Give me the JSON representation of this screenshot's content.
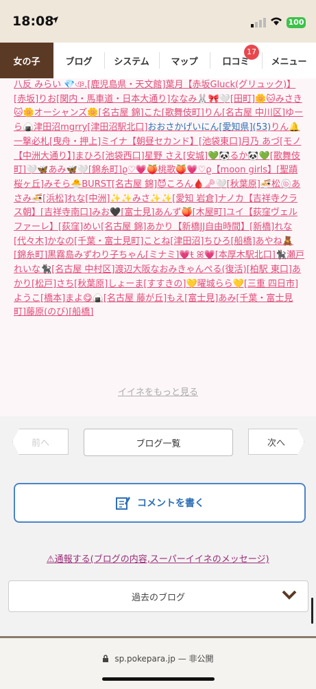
{
  "status": {
    "time": "18:08",
    "battery": "100"
  },
  "nav": {
    "tabs": [
      {
        "label": "女の子"
      },
      {
        "label": "ブログ"
      },
      {
        "label": "システム"
      },
      {
        "label": "マップ"
      },
      {
        "label": "口コミ"
      },
      {
        "label": "メニュー"
      }
    ],
    "review_badge": "17"
  },
  "likes": {
    "names": [
      "八反 みらい 💎ঞ.[鹿児島県・天文館]",
      "葉月【赤坂Gluck(グリュック)】[赤坂]",
      "りお[関内・馬車道・日本大通り]",
      "ななみ🐰🎀🤍[田町]",
      "🌼🐱みさき🐱🌼オーシャンズ🌼[名古屋 錦]",
      "こた[歌舞伎町]",
      "りん[名古屋 中川区]",
      "ゆーら🍙津田沼mgrry[津田沼駅北口]"
    ],
    "blue_name": "おおさかげいにん[愛知県](53)",
    "names2": [
      "りん🔔一撃必札[曳舟・押上]",
      "ミイナ【朝昼セカンド】[池袋東口]",
      "月乃 あづ[モノ【中洲大通り】]",
      "まひろ[池袋西口]",
      "星野 さえ[安城]💚🐼るか🐼💚[歌舞伎町]",
      "🤍🦋あみ🦋🤍[錦糸町]",
      "ϱ♡💗🍑桃歌🍑💗♡ϱ【moon girls】[聖蹟桜ヶ丘]",
      "みそら🐣BURST[名古屋 錦]",
      "😈ころん🩸🗝🤍[秋葉原]",
      "🍜松🍥あさみ🍜[浜松]",
      "れな[中洲]",
      "✨✨みさ✨✨[愛知 岩倉]",
      "ナノカ【吉祥寺クラス朝】[吉祥寺南口]",
      "みお🖤[富士見]",
      "あんず🍑[木屋町]",
      "ユイ【荻窪ヴェルファーレ】[荻窪]",
      "めい[名古屋 錦]",
      "あかり【新橋JJ自由時間】[新橋]",
      "れな[代々木]",
      "かなの[千葉・富士見町]",
      "ことね[津田沼]",
      "ちひろ[船橋]",
      "あやね🧸[錦糸町]",
      "黒霧島みずわり子ちゃん[ミナミ]",
      "💗ŧ ꕤ💗[本厚木駅北口]",
      "🐈‍⬛瀬戸 れいな🐈‍⬛[名古屋 中村区]",
      "渡辺大阪なおみきゃんぺる(復活)[柏駅 東口]",
      "あかり[松戸]",
      "さち[秋葉原]",
      "しょーま[すすきの]",
      "💛曜城らら💛[三重 四日市]",
      "ようこ[橋本]",
      "まよ😋🍙[名古屋 藤が丘]",
      "もえ[富士見]",
      "あみ[千葉・富士見町]",
      "藤原(のび)[船橋]"
    ],
    "more_label": "イイネをもっと見る"
  },
  "pager": {
    "prev": "前へ",
    "list": "ブログ一覧",
    "next": "次へ"
  },
  "comment_label": "コメントを書く",
  "report_label": "⚠通報する(ブログの内容,スーパーイイネのメッセージ)",
  "past_label": "過去のブログ",
  "url": "sp.pokepara.jp — 非公開",
  "colors": {
    "accent_brown": "#5a3a24",
    "name_pink": "#e14b7a",
    "link_blue": "#2d6fb5"
  }
}
